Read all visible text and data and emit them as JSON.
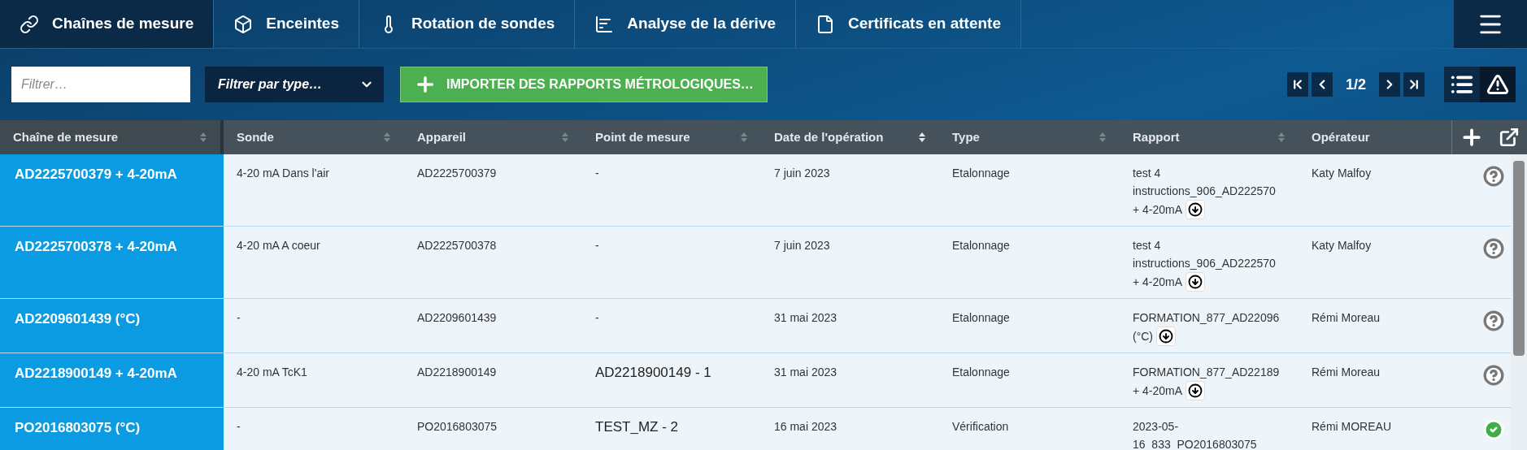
{
  "nav": {
    "tabs": [
      {
        "label": "Chaînes de mesure",
        "selected": true
      },
      {
        "label": "Enceintes",
        "selected": false
      },
      {
        "label": "Rotation de sondes",
        "selected": false
      },
      {
        "label": "Analyse de la dérive",
        "selected": false
      },
      {
        "label": "Certificats en attente",
        "selected": false
      }
    ]
  },
  "toolbar": {
    "filter": {
      "placeholder": "Filtrer…"
    },
    "type_filter": {
      "value": "Filtrer par type…"
    },
    "import_button": "IMPORTER DES RAPPORTS MÉTROLOGIQUES…",
    "pagination": "1/2",
    "alerts_view_selected": true
  },
  "table": {
    "columns": [
      {
        "label": "Chaîne de mesure",
        "sorted": false
      },
      {
        "label": "Sonde",
        "sorted": false
      },
      {
        "label": "Appareil",
        "sorted": false
      },
      {
        "label": "Point de mesure",
        "sorted": false
      },
      {
        "label": "Date de l'opération",
        "sorted": true
      },
      {
        "label": "Type",
        "sorted": false
      },
      {
        "label": "Rapport",
        "sorted": false
      },
      {
        "label": "Opérateur"
      }
    ],
    "rows": [
      {
        "chain": "AD2225700379 + 4-20mA",
        "sonde": "4-20 mA Dans l'air",
        "appareil": "AD2225700379",
        "point": {
          "text": "-",
          "emphasized": false
        },
        "date": "7 juin 2023",
        "type": "Etalonnage",
        "rapport": [
          "test 4",
          "instructions_906_AD222570",
          "+ 4-20mA"
        ],
        "download": true,
        "operator": "Katy Malfoy",
        "verified": false
      },
      {
        "chain": "AD2225700378 + 4-20mA",
        "sonde": "4-20 mA A coeur",
        "appareil": "AD2225700378",
        "point": {
          "text": "-",
          "emphasized": false
        },
        "date": "7 juin 2023",
        "type": "Etalonnage",
        "rapport": [
          "test 4",
          "instructions_906_AD222570",
          "+ 4-20mA"
        ],
        "download": true,
        "operator": "Katy Malfoy",
        "verified": false
      },
      {
        "chain": "AD2209601439 (°C)",
        "sonde": "-",
        "appareil": "AD2209601439",
        "point": {
          "text": "-",
          "emphasized": false
        },
        "date": "31 mai 2023",
        "type": "Etalonnage",
        "rapport": [
          "FORMATION_877_AD22096",
          "(°C)"
        ],
        "download": true,
        "operator": "Rémi Moreau",
        "verified": false
      },
      {
        "chain": "AD2218900149 + 4-20mA",
        "sonde": "4-20 mA TcK1",
        "appareil": "AD2218900149",
        "point": {
          "text": "AD2218900149 - 1",
          "emphasized": true
        },
        "date": "31 mai 2023",
        "type": "Etalonnage",
        "rapport": [
          "FORMATION_877_AD22189",
          "+ 4-20mA"
        ],
        "download": true,
        "operator": "Rémi Moreau",
        "verified": false
      },
      {
        "chain": "PO2016803075 (°C)",
        "sonde": "-",
        "appareil": "PO2016803075",
        "point": {
          "text": "TEST_MZ - 2",
          "emphasized": true
        },
        "date": "16 mai 2023",
        "type": "Vérification",
        "rapport": [
          "2023-05-",
          "16_833_PO2016803075"
        ],
        "download": false,
        "operator": "Rémi MOREAU",
        "verified": true
      }
    ]
  }
}
